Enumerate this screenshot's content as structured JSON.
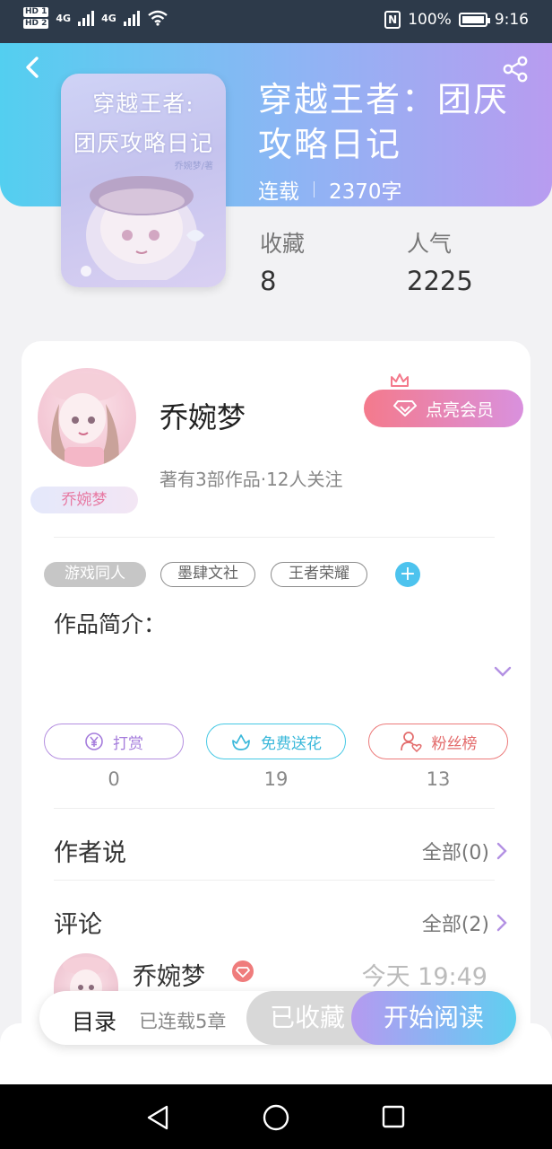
{
  "status_bar": {
    "hd1": "HD 1",
    "hd2": "HD 2",
    "net1": "4G",
    "net2": "4G",
    "nfc": "N",
    "battery": "100%",
    "time": "9:16"
  },
  "book": {
    "title": "穿越王者：团厌攻略日记",
    "status": "连载",
    "word_count": "2370字",
    "cover_line1": "穿越王者:",
    "cover_line2": "团厌攻略日记",
    "cover_author": "乔婉梦/著"
  },
  "stats": [
    {
      "label": "收藏",
      "value": "8"
    },
    {
      "label": "人气",
      "value": "2225"
    }
  ],
  "author": {
    "name": "乔婉梦",
    "badge": "乔婉梦",
    "meta": "著有3部作品·12人关注",
    "vip_button": "点亮会员"
  },
  "tags": [
    "游戏同人",
    "墨肆文社",
    "王者荣耀"
  ],
  "intro_label": "作品简介：",
  "actions": [
    {
      "label": "打赏",
      "count": "0",
      "icon": "yen-icon"
    },
    {
      "label": "免费送花",
      "count": "19",
      "icon": "flower-icon"
    },
    {
      "label": "粉丝榜",
      "count": "13",
      "icon": "fan-icon"
    }
  ],
  "author_says": {
    "title": "作者说",
    "link": "全部(0)"
  },
  "comments": {
    "title": "评论",
    "link": "全部(2)",
    "first": {
      "name": "乔婉梦",
      "time": "今天 19:49"
    }
  },
  "bottom": {
    "toc": "目录",
    "chapters": "已连载5章",
    "collected": "已收藏",
    "read": "开始阅读"
  },
  "colors": {
    "header_start": "#53cff0",
    "header_end": "#b89cf0",
    "vip_start": "#f47a8c",
    "vip_end": "#d991de"
  }
}
